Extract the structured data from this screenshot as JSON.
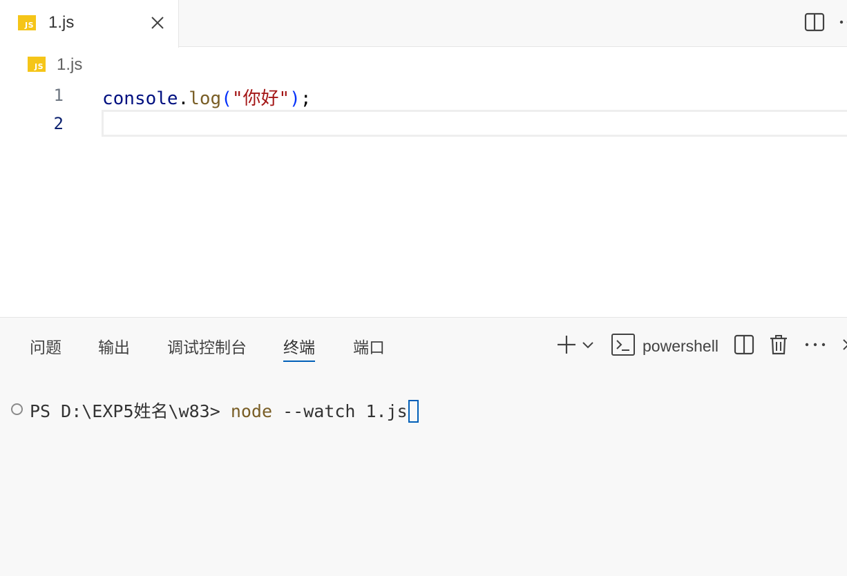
{
  "tabbar": {
    "active_tab": {
      "icon": "js-file-icon",
      "badge_text": "JS",
      "label": "1.js",
      "close_icon": "close-icon"
    },
    "actions": [
      {
        "name": "split-editor",
        "icon": "split-editor-icon"
      },
      {
        "name": "more-actions",
        "icon": "more-icon"
      }
    ]
  },
  "breadcrumb": {
    "icon": "js-file-icon",
    "badge_text": "JS",
    "label": "1.js"
  },
  "editor": {
    "lines": [
      {
        "number": "1",
        "tokens": {
          "obj": "console",
          "dot": ".",
          "fn": "log",
          "open": "(",
          "str": "\"你好\"",
          "close": ")",
          "semi": ";"
        }
      },
      {
        "number": "2",
        "text": ""
      }
    ],
    "active_line": 2
  },
  "panel": {
    "tabs": [
      {
        "label": "问题",
        "active": false
      },
      {
        "label": "输出",
        "active": false
      },
      {
        "label": "调试控制台",
        "active": false
      },
      {
        "label": "终端",
        "active": true
      },
      {
        "label": "端口",
        "active": false
      }
    ],
    "actions": {
      "new_terminal_icon": "plus-icon",
      "dropdown_icon": "chevron-down-icon",
      "shell_icon": "terminal-icon",
      "shell_label": "powershell",
      "split_icon": "split-terminal-icon",
      "kill_icon": "trash-icon",
      "more_icon": "more-icon",
      "close_icon": "close-panel-icon"
    }
  },
  "terminal": {
    "prompt": "PS D:\\EXP5姓名\\w83> ",
    "command": "node",
    "args": " --watch 1.js",
    "colors": {
      "command": "#795e26",
      "cursor": "#005fb8"
    }
  }
}
